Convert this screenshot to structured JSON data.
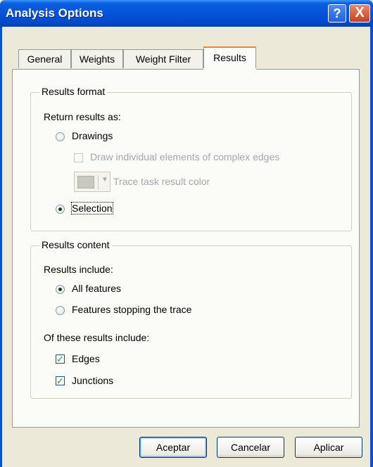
{
  "window": {
    "title": "Analysis Options",
    "help_label": "?",
    "close_label": "X"
  },
  "tabs": [
    {
      "label": "General",
      "active": false
    },
    {
      "label": "Weights",
      "active": false
    },
    {
      "label": "Weight Filter",
      "active": false
    },
    {
      "label": "Results",
      "active": true
    }
  ],
  "results_format": {
    "legend": "Results format",
    "return_as_label": "Return results as:",
    "option_drawings": "Drawings",
    "draw_individual_label": "Draw individual elements of complex edges",
    "trace_color_label": "Trace task result color",
    "option_selection": "Selection",
    "selected": "Selection"
  },
  "results_content": {
    "legend": "Results content",
    "include_label": "Results include:",
    "option_all": "All features",
    "option_stopping": "Features stopping the trace",
    "selected": "All features",
    "of_these_label": "Of these results include:",
    "edges_label": "Edges",
    "edges_checked": true,
    "junctions_label": "Junctions",
    "junctions_checked": true,
    "check_mark": "✓"
  },
  "buttons": {
    "ok": "Aceptar",
    "cancel": "Cancelar",
    "apply": "Aplicar"
  },
  "colors": {
    "titlebar": "#0451d8",
    "dialog_bg": "#ece9d8",
    "panel_bg": "#fbfbf8",
    "active_tab_accent": "#e68b2c",
    "check_green": "#21a121"
  }
}
